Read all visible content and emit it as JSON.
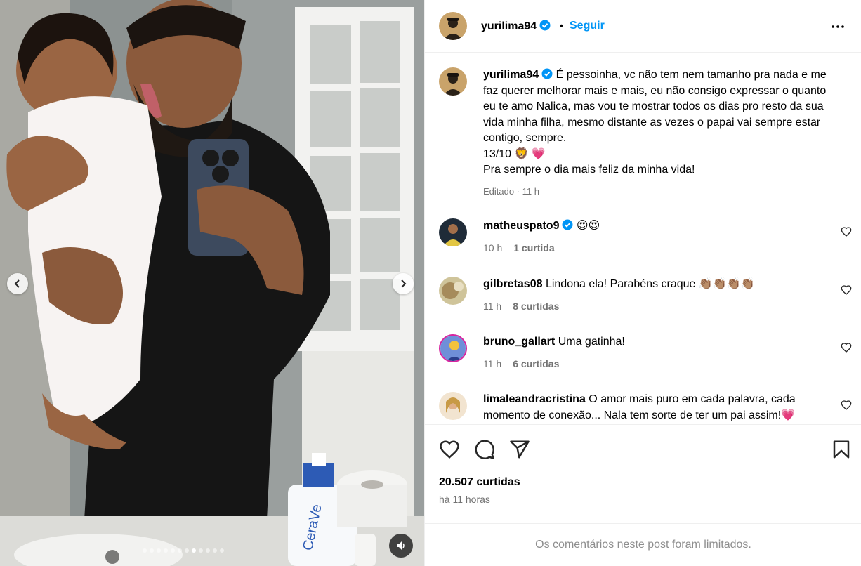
{
  "post": {
    "username": "yurilima94",
    "separator": "•",
    "follow_label": "Seguir",
    "caption": {
      "username": "yurilima94",
      "text": "É pessoinha, vc não tem nem tamanho pra nada e me faz querer melhorar mais e mais, eu não consigo expressar o quanto eu te amo Nalica, mas vou te mostrar todos os dias pro resto da sua vida minha filha, mesmo distante as vezes o papai vai sempre estar contigo, sempre.",
      "date_line": "13/10 🦁 💗",
      "last_line": "Pra sempre o dia mais feliz da minha vida!",
      "meta": "Editado · 11 h"
    },
    "comments": [
      {
        "username": "matheuspato9",
        "text": "😍😍",
        "time": "10 h",
        "likes": "1 curtida",
        "verified": true
      },
      {
        "username": "gilbretas08",
        "text": "Lindona ela! Parabéns craque 👏🏽👏🏽👏🏽👏🏽",
        "time": "11 h",
        "likes": "8 curtidas",
        "verified": false
      },
      {
        "username": "bruno_gallart",
        "text": "Uma gatinha!",
        "time": "11 h",
        "likes": "6 curtidas",
        "verified": false
      },
      {
        "username": "limaleandracristina",
        "text": "O amor mais puro em cada palavra, cada momento de conexão... Nala tem sorte de ter um pai assim!💗",
        "time": "",
        "likes": "",
        "verified": false
      }
    ],
    "likes_count": "20.507 curtidas",
    "time_ago": "há 11 horas",
    "comments_limited": "Os comentários neste post foram limitados."
  },
  "carousel": {
    "total": 12,
    "current": 8
  },
  "colors": {
    "accent": "#0095f6",
    "verified": "#0095f6",
    "muted": "#737373"
  },
  "icons": [
    "chevron-left-icon",
    "chevron-right-icon",
    "volume-icon",
    "more-icon",
    "verified-icon",
    "heart-icon",
    "comment-icon",
    "share-icon",
    "bookmark-icon"
  ]
}
